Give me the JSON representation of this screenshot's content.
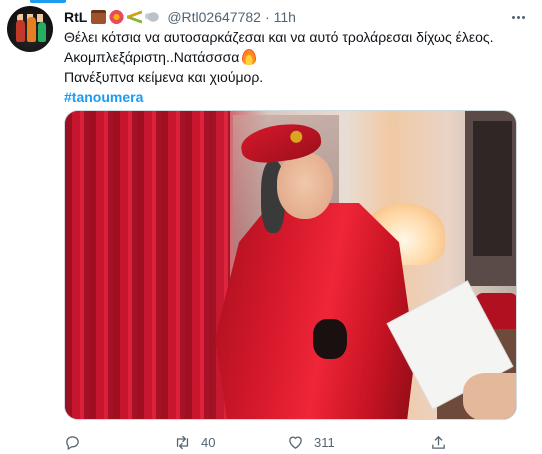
{
  "tweet": {
    "display_name": "RtL",
    "handle": "@Rtl02647782",
    "separator": "·",
    "time": "11h",
    "name_emojis": [
      "briefcase-emoji",
      "flower-emoji",
      "sheaf-emoji",
      "dove-emoji"
    ],
    "lines": [
      "Θέλει κότσια να αυτοσαρκάζεσαι και να αυτό τρολάρεσαι δίχως έλεος.",
      "Ακομπλεξάριστη..Νατάσσσα",
      "Πανέξυπνα κείμενα και χιούμορ."
    ],
    "hashtag": "#tanoumera",
    "media_alt": "photo"
  },
  "actions": {
    "reply_count": "",
    "retweet_count": "40",
    "like_count": "311"
  },
  "colors": {
    "accent": "#1d9bf0",
    "secondary_text": "#536471",
    "primary_text": "#0f1419"
  }
}
